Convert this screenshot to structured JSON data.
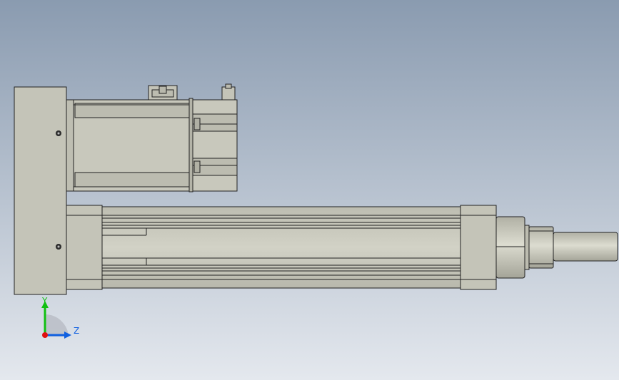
{
  "viewport": {
    "background_top": "#8a9bb0",
    "background_bottom": "#e4e8ee"
  },
  "model": {
    "fill": "#c8c8bc",
    "fill_light": "#d6d6ca",
    "fill_dark": "#9c9c90",
    "edge": "#222222"
  },
  "triad": {
    "y_label": "Y",
    "z_label": "Z",
    "y_color": "#10c010",
    "z_color": "#1060e0",
    "x_color": "#e01010"
  }
}
